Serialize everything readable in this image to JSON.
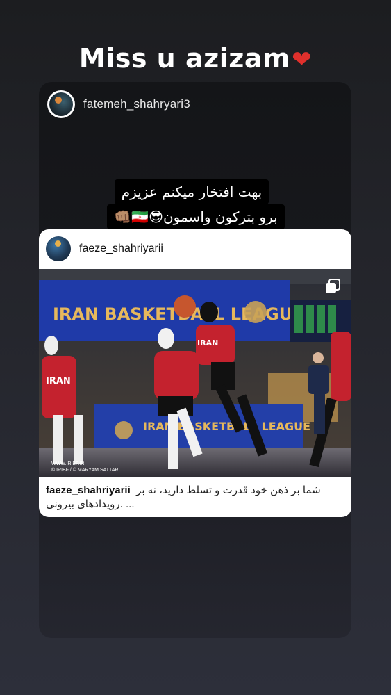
{
  "story": {
    "title_text": "Miss u azizam",
    "title_emoji": "❤",
    "author_username": "fatemeh_shahryari3",
    "caption_line1": "بهت افتخار میکنم عزیزم",
    "caption_line2": "برو بترکون واسمون😎🇮🇷👊🏽"
  },
  "post": {
    "username": "faeze_shahriyarii",
    "caption": "شما بر ذهن خود قدرت و تسلط دارید، نه بر رویدادهای بیرونی. ...",
    "banner_text": "IRAN BASKETBALL LEAGUE",
    "banner_text_lower": "IRAN BASKETBALL LEAGUE",
    "jersey_text": "IRAN",
    "watermark_line1": "WWW.IRIBF.IR",
    "watermark_line2": "© IRIBF / © MARYAM SATTARI",
    "multi_icon": "carousel-icon"
  },
  "colors": {
    "background_top": "#1c1d20",
    "background_bottom": "#2d2f3a",
    "banner_blue": "#1f3aa8",
    "jersey_red": "#c4222e",
    "heart": "#e0302c"
  }
}
